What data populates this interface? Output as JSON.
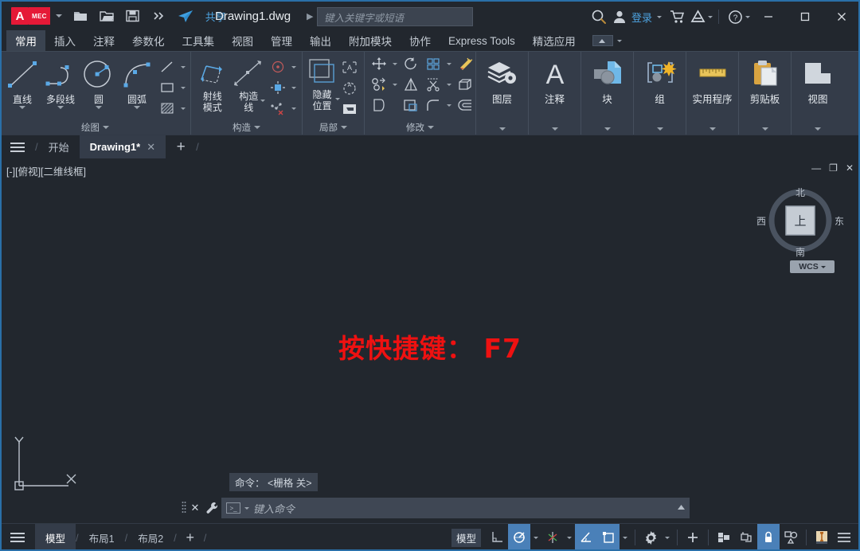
{
  "titlebar": {
    "logo_text": "A",
    "logo_badge": "MEC",
    "quick_access": [
      {
        "name": "new-file-icon",
        "label": "新建"
      },
      {
        "name": "open-file-icon",
        "label": "打开"
      },
      {
        "name": "save-icon",
        "label": "保存"
      },
      {
        "name": "more-qat-icon",
        "label": "更多"
      },
      {
        "name": "share-icon",
        "label": "共享"
      }
    ],
    "share_label": "共享",
    "document_title": "Drawing1.dwg",
    "search_placeholder": "键入关键字或短语",
    "search_icon": "search-icon",
    "account_icon": "user-icon",
    "login_label": "登录",
    "cart_icon": "cart-icon",
    "autodesk_icon": "autodesk-icon",
    "help_icon": "help-icon",
    "window_minimize": "—",
    "window_maximize": "▢",
    "window_close": "✕"
  },
  "ribbon_tabs": {
    "items": [
      {
        "label": "常用",
        "active": true
      },
      {
        "label": "插入",
        "active": false
      },
      {
        "label": "注释",
        "active": false
      },
      {
        "label": "参数化",
        "active": false
      },
      {
        "label": "工具集",
        "active": false
      },
      {
        "label": "视图",
        "active": false
      },
      {
        "label": "管理",
        "active": false
      },
      {
        "label": "输出",
        "active": false
      },
      {
        "label": "附加模块",
        "active": false
      },
      {
        "label": "协作",
        "active": false
      },
      {
        "label": "Express Tools",
        "active": false
      },
      {
        "label": "精选应用",
        "active": false
      }
    ]
  },
  "ribbon": {
    "panels": [
      {
        "title": "绘图",
        "big_buttons": [
          {
            "label": "直线",
            "icon": "line-icon"
          },
          {
            "label": "多段线",
            "icon": "polyline-icon"
          },
          {
            "label": "圆",
            "icon": "circle-icon"
          },
          {
            "label": "圆弧",
            "icon": "arc-icon"
          }
        ],
        "small_buttons": [
          {
            "icon": "line-small-icon"
          },
          {
            "icon": "rectangle-icon"
          },
          {
            "icon": "hatch-icon"
          }
        ]
      },
      {
        "title": "构造",
        "big_buttons": [
          {
            "label": "射线\n模式",
            "line1": "射线",
            "line2": "模式",
            "icon": "ray-mode-icon"
          },
          {
            "label": "构造\n线",
            "line1": "构造",
            "line2": "线",
            "icon": "construction-line-icon"
          }
        ],
        "small_buttons": [
          {
            "icon": "center-mark-icon"
          },
          {
            "icon": "constraint-point-icon"
          },
          {
            "icon": "delete-constraint-icon"
          }
        ]
      },
      {
        "title": "局部",
        "big_buttons": [
          {
            "line1": "隐藏",
            "line2": "位置",
            "icon": "hide-position-icon"
          }
        ],
        "small_buttons": [
          {
            "icon": "text-align-icon"
          },
          {
            "icon": "rotate-view-icon"
          },
          {
            "icon": "section-icon"
          }
        ]
      },
      {
        "title": "修改",
        "small_buttons": [
          {
            "icon": "move-icon"
          },
          {
            "icon": "rotate-icon"
          },
          {
            "icon": "array-icon"
          },
          {
            "icon": "erase-icon"
          },
          {
            "icon": "copy-icon"
          },
          {
            "icon": "mirror-icon"
          },
          {
            "icon": "trim-icon"
          },
          {
            "icon": "extrude-icon"
          },
          {
            "icon": "stretch-icon"
          },
          {
            "icon": "scale-icon"
          },
          {
            "icon": "fillet-icon"
          },
          {
            "icon": "offset-icon"
          }
        ]
      }
    ],
    "big_panels": [
      {
        "label": "图层",
        "icon": "layers-icon"
      },
      {
        "label": "注释",
        "icon": "annotation-icon"
      },
      {
        "label": "块",
        "icon": "block-icon"
      },
      {
        "label": "组",
        "icon": "group-icon"
      },
      {
        "label": "实用程序",
        "icon": "utilities-icon"
      },
      {
        "label": "剪贴板",
        "icon": "clipboard-icon"
      },
      {
        "label": "视图",
        "icon": "view-icon"
      }
    ]
  },
  "file_tabs": {
    "menu_icon": "hamburger-icon",
    "items": [
      {
        "label": "开始",
        "active": false,
        "closable": false
      },
      {
        "label": "Drawing1*",
        "active": true,
        "closable": true
      }
    ],
    "add_label": "+"
  },
  "canvas": {
    "viewport_label": "[-][俯视][二维线框]",
    "viewport_controls": [
      "—",
      "❐",
      "✕"
    ],
    "viewcube": {
      "top_face": "上",
      "north": "北",
      "south": "南",
      "east": "东",
      "west": "西",
      "ucs_label": "WCS"
    },
    "hint_text": "按快捷键： F7",
    "hint_color": "#ee1111",
    "ucs_x_label": "X",
    "ucs_y_label": "Y",
    "command_history": "命令： <栅格 关>",
    "command_placeholder": "键入命令"
  },
  "status_bar": {
    "menu_icon": "hamburger-icon",
    "tabs": [
      {
        "label": "模型",
        "active": true
      },
      {
        "label": "布局1",
        "active": false
      },
      {
        "label": "布局2",
        "active": false
      }
    ],
    "add_label": "+",
    "space_label": "模型",
    "toggles": [
      {
        "name": "ortho-icon",
        "on": false
      },
      {
        "name": "polar-tracking-icon",
        "on": true
      },
      {
        "name": "osnap-icon",
        "on": false
      },
      {
        "name": "isodraft-icon",
        "on": true
      },
      {
        "name": "object-snap-tracking-icon",
        "on": true
      },
      {
        "name": "settings-gear-icon",
        "on": false
      },
      {
        "name": "customize-plus-icon",
        "on": false
      },
      {
        "name": "workspace-icon",
        "on": false
      },
      {
        "name": "hardware-accel-icon",
        "on": false
      },
      {
        "name": "lock-ui-icon",
        "on": true
      },
      {
        "name": "isolate-objects-icon",
        "on": false
      },
      {
        "name": "annotation-scale-icon",
        "on": false
      },
      {
        "name": "status-menu-icon",
        "on": false
      }
    ]
  },
  "colors": {
    "accent": "#2a6fa8",
    "ribbon_bg": "#343c49",
    "chrome_bg": "#22272e",
    "canvas_bg": "#22272e",
    "brand_red": "#e51937",
    "link_blue": "#4da3e0",
    "toggle_on": "#4a80b8"
  }
}
